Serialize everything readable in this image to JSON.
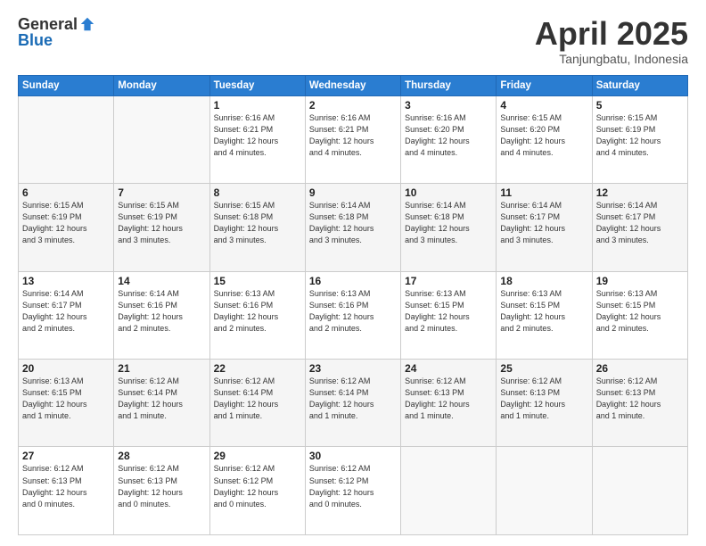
{
  "header": {
    "logo_general": "General",
    "logo_blue": "Blue",
    "title": "April 2025",
    "location": "Tanjungbatu, Indonesia"
  },
  "weekdays": [
    "Sunday",
    "Monday",
    "Tuesday",
    "Wednesday",
    "Thursday",
    "Friday",
    "Saturday"
  ],
  "weeks": [
    [
      {
        "day": "",
        "info": ""
      },
      {
        "day": "",
        "info": ""
      },
      {
        "day": "1",
        "info": "Sunrise: 6:16 AM\nSunset: 6:21 PM\nDaylight: 12 hours\nand 4 minutes."
      },
      {
        "day": "2",
        "info": "Sunrise: 6:16 AM\nSunset: 6:21 PM\nDaylight: 12 hours\nand 4 minutes."
      },
      {
        "day": "3",
        "info": "Sunrise: 6:16 AM\nSunset: 6:20 PM\nDaylight: 12 hours\nand 4 minutes."
      },
      {
        "day": "4",
        "info": "Sunrise: 6:15 AM\nSunset: 6:20 PM\nDaylight: 12 hours\nand 4 minutes."
      },
      {
        "day": "5",
        "info": "Sunrise: 6:15 AM\nSunset: 6:19 PM\nDaylight: 12 hours\nand 4 minutes."
      }
    ],
    [
      {
        "day": "6",
        "info": "Sunrise: 6:15 AM\nSunset: 6:19 PM\nDaylight: 12 hours\nand 3 minutes."
      },
      {
        "day": "7",
        "info": "Sunrise: 6:15 AM\nSunset: 6:19 PM\nDaylight: 12 hours\nand 3 minutes."
      },
      {
        "day": "8",
        "info": "Sunrise: 6:15 AM\nSunset: 6:18 PM\nDaylight: 12 hours\nand 3 minutes."
      },
      {
        "day": "9",
        "info": "Sunrise: 6:14 AM\nSunset: 6:18 PM\nDaylight: 12 hours\nand 3 minutes."
      },
      {
        "day": "10",
        "info": "Sunrise: 6:14 AM\nSunset: 6:18 PM\nDaylight: 12 hours\nand 3 minutes."
      },
      {
        "day": "11",
        "info": "Sunrise: 6:14 AM\nSunset: 6:17 PM\nDaylight: 12 hours\nand 3 minutes."
      },
      {
        "day": "12",
        "info": "Sunrise: 6:14 AM\nSunset: 6:17 PM\nDaylight: 12 hours\nand 3 minutes."
      }
    ],
    [
      {
        "day": "13",
        "info": "Sunrise: 6:14 AM\nSunset: 6:17 PM\nDaylight: 12 hours\nand 2 minutes."
      },
      {
        "day": "14",
        "info": "Sunrise: 6:14 AM\nSunset: 6:16 PM\nDaylight: 12 hours\nand 2 minutes."
      },
      {
        "day": "15",
        "info": "Sunrise: 6:13 AM\nSunset: 6:16 PM\nDaylight: 12 hours\nand 2 minutes."
      },
      {
        "day": "16",
        "info": "Sunrise: 6:13 AM\nSunset: 6:16 PM\nDaylight: 12 hours\nand 2 minutes."
      },
      {
        "day": "17",
        "info": "Sunrise: 6:13 AM\nSunset: 6:15 PM\nDaylight: 12 hours\nand 2 minutes."
      },
      {
        "day": "18",
        "info": "Sunrise: 6:13 AM\nSunset: 6:15 PM\nDaylight: 12 hours\nand 2 minutes."
      },
      {
        "day": "19",
        "info": "Sunrise: 6:13 AM\nSunset: 6:15 PM\nDaylight: 12 hours\nand 2 minutes."
      }
    ],
    [
      {
        "day": "20",
        "info": "Sunrise: 6:13 AM\nSunset: 6:15 PM\nDaylight: 12 hours\nand 1 minute."
      },
      {
        "day": "21",
        "info": "Sunrise: 6:12 AM\nSunset: 6:14 PM\nDaylight: 12 hours\nand 1 minute."
      },
      {
        "day": "22",
        "info": "Sunrise: 6:12 AM\nSunset: 6:14 PM\nDaylight: 12 hours\nand 1 minute."
      },
      {
        "day": "23",
        "info": "Sunrise: 6:12 AM\nSunset: 6:14 PM\nDaylight: 12 hours\nand 1 minute."
      },
      {
        "day": "24",
        "info": "Sunrise: 6:12 AM\nSunset: 6:13 PM\nDaylight: 12 hours\nand 1 minute."
      },
      {
        "day": "25",
        "info": "Sunrise: 6:12 AM\nSunset: 6:13 PM\nDaylight: 12 hours\nand 1 minute."
      },
      {
        "day": "26",
        "info": "Sunrise: 6:12 AM\nSunset: 6:13 PM\nDaylight: 12 hours\nand 1 minute."
      }
    ],
    [
      {
        "day": "27",
        "info": "Sunrise: 6:12 AM\nSunset: 6:13 PM\nDaylight: 12 hours\nand 0 minutes."
      },
      {
        "day": "28",
        "info": "Sunrise: 6:12 AM\nSunset: 6:13 PM\nDaylight: 12 hours\nand 0 minutes."
      },
      {
        "day": "29",
        "info": "Sunrise: 6:12 AM\nSunset: 6:12 PM\nDaylight: 12 hours\nand 0 minutes."
      },
      {
        "day": "30",
        "info": "Sunrise: 6:12 AM\nSunset: 6:12 PM\nDaylight: 12 hours\nand 0 minutes."
      },
      {
        "day": "",
        "info": ""
      },
      {
        "day": "",
        "info": ""
      },
      {
        "day": "",
        "info": ""
      }
    ]
  ]
}
